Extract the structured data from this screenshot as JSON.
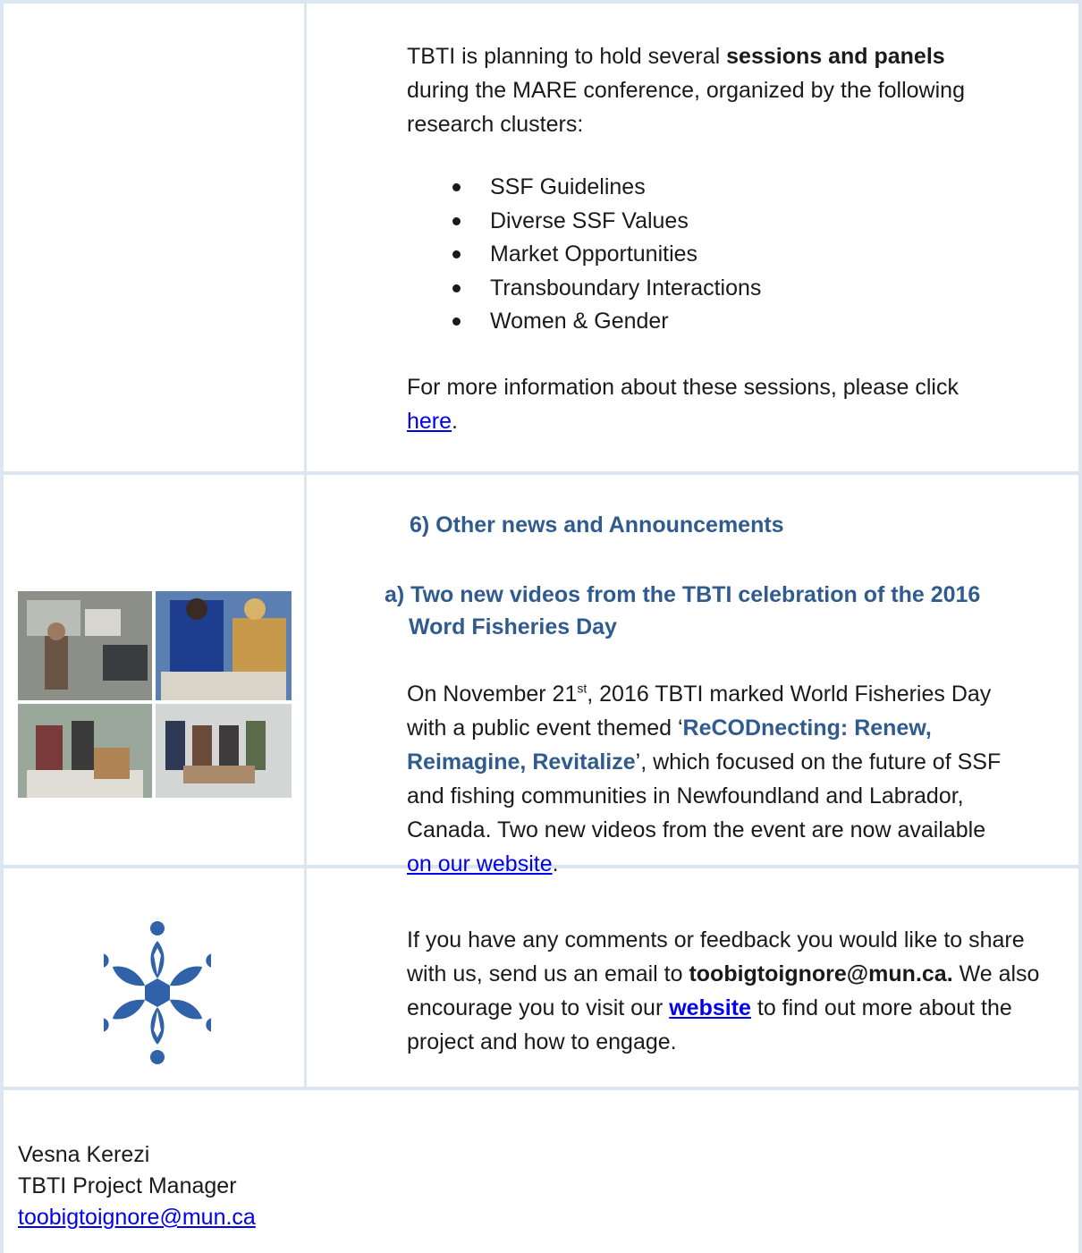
{
  "section1": {
    "intro_prefix": "TBTI is planning to hold several ",
    "intro_bold": "sessions and panels",
    "intro_suffix": " during the MARE conference, organized by the following research clusters:",
    "clusters": [
      "SSF Guidelines",
      "Diverse SSF Values",
      "Market Opportunities",
      "Transboundary Interactions",
      "Women & Gender"
    ],
    "more_prefix": "For more information about these sessions, please click ",
    "more_link": "here",
    "more_suffix": "."
  },
  "section2": {
    "heading": "6)   Other news and Announcements",
    "sub_heading_line1": "a)   Two new videos from the TBTI celebration of the 2016",
    "sub_heading_line2": "Word Fisheries Day",
    "p_prefix": "On November 21",
    "p_sup": "st",
    "p_mid1": ", 2016 TBTI marked World Fisheries Day with a public event themed ‘",
    "p_event": "ReCODnecting: Renew, Reimagine, Revitalize",
    "p_mid2": "’, which focused on the future of SSF and fishing communities in Newfoundland and Labrador, Canada. Two new videos from the event are now available ",
    "p_link": "on our website",
    "p_suffix": "."
  },
  "section3": {
    "p1": "If you have any comments or feedback you would like to share with us, send us an email to ",
    "email_bold": "toobigtoignore@mun.ca.",
    "p2": " We also encourage you to visit our ",
    "website_link": "website",
    "p3": " to find out more about the project and how to engage."
  },
  "signature": {
    "name": "Vesna Kerezi",
    "role": "TBTI Project Manager",
    "email": "toobigtoignore@mun.ca"
  },
  "colors": {
    "border": "#dce6f0",
    "heading": "#2f5b8f",
    "link": "#0000ee",
    "logo": "#2f62a8"
  }
}
